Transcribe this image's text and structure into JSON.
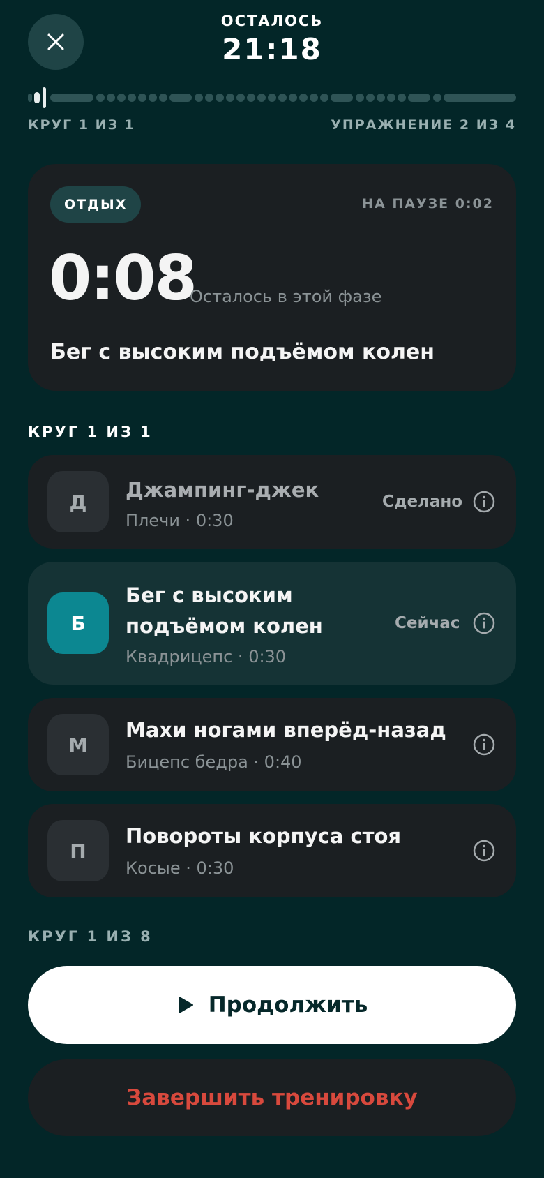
{
  "header": {
    "remaining_label": "ОСТАЛОСЬ",
    "remaining_time": "21:18"
  },
  "progress": {
    "round_label": "КРУГ 1 ИЗ 1",
    "exercise_label": "УПРАЖНЕНИЕ 2 ИЗ 4",
    "fraction": 0.03
  },
  "phase": {
    "badge": "ОТДЫХ",
    "paused": "НА ПАУЗЕ 0:02",
    "timer": "0:08",
    "timer_caption": "Осталось в этой фазе",
    "exercise": "Бег с высоким подъёмом колен"
  },
  "round_section": {
    "label": "КРУГ 1 ИЗ 1"
  },
  "exercises": [
    {
      "initial": "Д",
      "title": "Джампинг-джек",
      "subtitle": "Плечи · 0:30",
      "status": "Сделано"
    },
    {
      "initial": "Б",
      "title_line1": "Бег с высоким",
      "title_line2": "подъёмом колен",
      "subtitle": "Квадрицепс · 0:30",
      "status": "Сейчас"
    },
    {
      "initial": "М",
      "title": "Махи ногами вперёд-назад",
      "subtitle": "Бицепс бедра · 0:40",
      "status": ""
    },
    {
      "initial": "П",
      "title": "Повороты корпуса стоя",
      "subtitle": "Косые · 0:30",
      "status": ""
    }
  ],
  "next_section": {
    "label": "КРУГ 1 ИЗ 8"
  },
  "actions": {
    "continue": "Продолжить",
    "finish": "Завершить тренировку"
  },
  "colors": {
    "background": "#032628",
    "card": "#1b1f22",
    "accent": "#0c8791",
    "danger": "#d8493d"
  }
}
